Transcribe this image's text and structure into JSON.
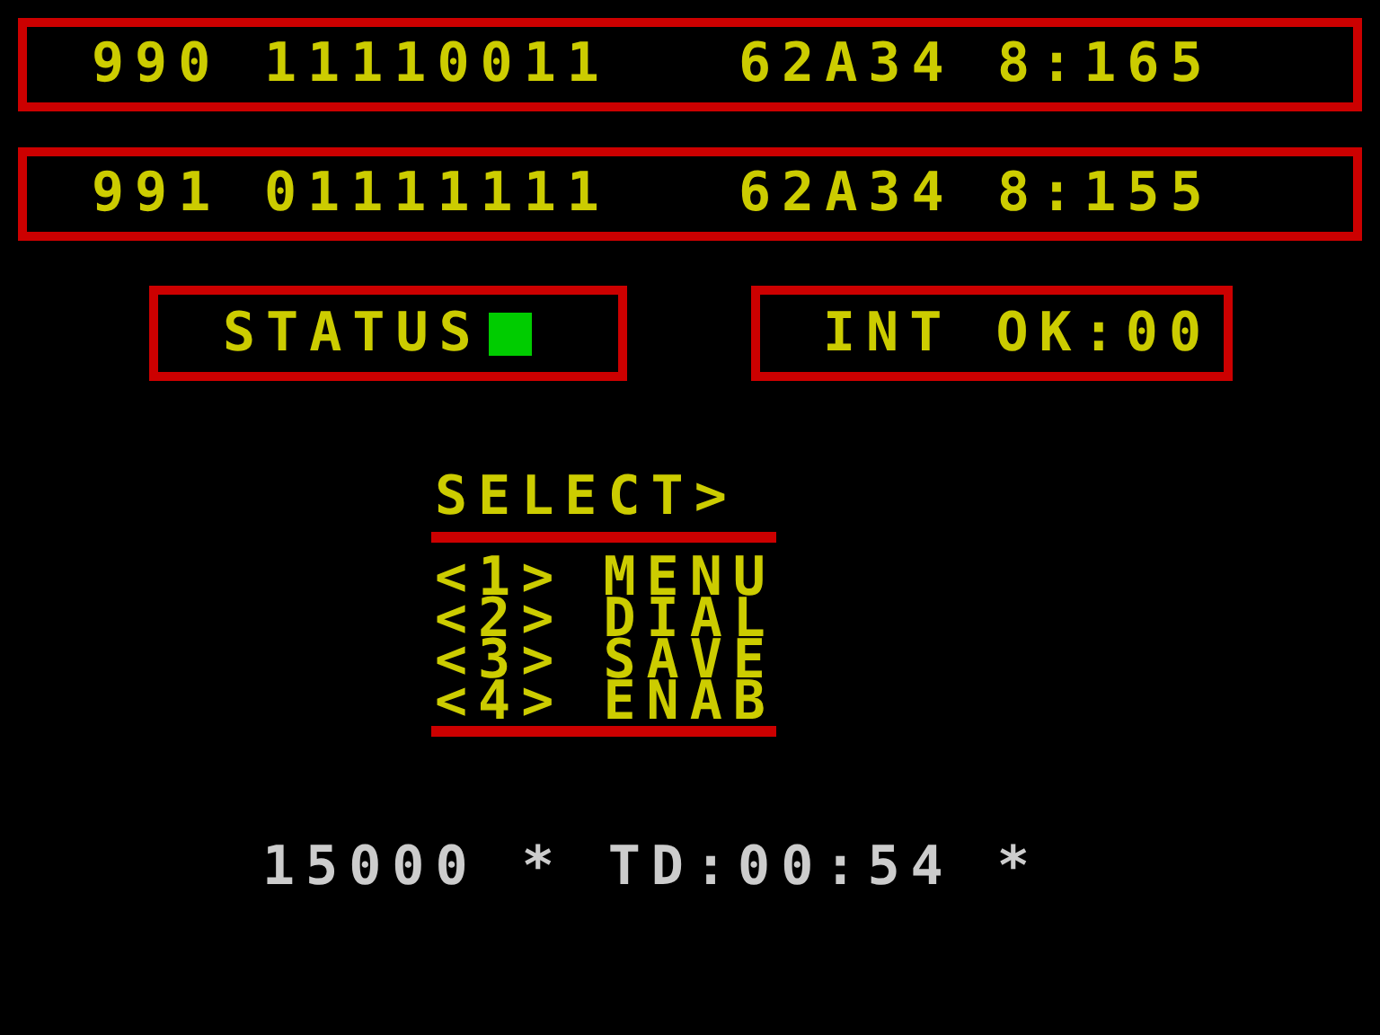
{
  "records": [
    {
      "id": "990",
      "bits": "11110011",
      "code": "62A34",
      "time": "8:165"
    },
    {
      "id": "991",
      "bits": "01111111",
      "code": "62A34",
      "time": "8:155"
    }
  ],
  "status": {
    "label": "STATUS",
    "lit": true
  },
  "interrupt": {
    "label": "INT OK:00"
  },
  "menu": {
    "prompt": "SELECT>",
    "items": [
      {
        "key": "<1>",
        "label": "MENU"
      },
      {
        "key": "<2>",
        "label": "DIAL"
      },
      {
        "key": "<3>",
        "label": "SAVE"
      },
      {
        "key": "<4>",
        "label": "ENAB"
      }
    ]
  },
  "footer": {
    "count": "15000",
    "marks": [
      "*",
      "*"
    ],
    "timer": "TD:00:54"
  }
}
